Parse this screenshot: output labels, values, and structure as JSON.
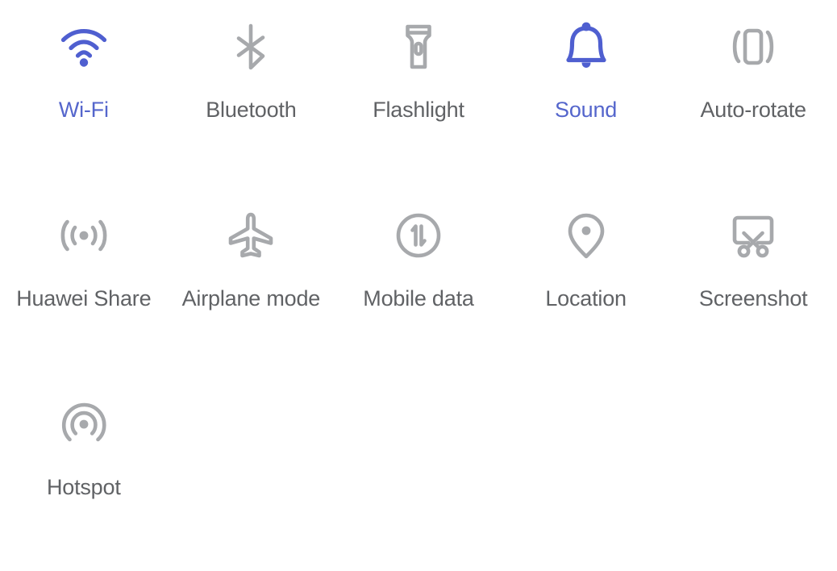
{
  "panel": {
    "name": "quick-settings",
    "background_color": "#ffffff",
    "columns": 5,
    "rows": 3
  },
  "colors": {
    "active_blue": "#5566cc",
    "active_icon_blue": "#4f5fd0",
    "inactive_gray_text": "#606265",
    "inactive_gray_icon": "#a7a9ac",
    "background": "#ffffff"
  },
  "tiles": [
    {
      "label": "Wi-Fi",
      "icon": "wifi-icon",
      "state": "on"
    },
    {
      "label": "Bluetooth",
      "icon": "bluetooth-icon",
      "state": "off"
    },
    {
      "label": "Flashlight",
      "icon": "flashlight-icon",
      "state": "off"
    },
    {
      "label": "Sound",
      "icon": "bell-icon",
      "state": "on"
    },
    {
      "label": "Auto-rotate",
      "icon": "auto-rotate-icon",
      "state": "off"
    },
    {
      "label": "Huawei Share",
      "icon": "huawei-share-icon",
      "state": "off"
    },
    {
      "label": "Airplane mode",
      "icon": "airplane-icon",
      "state": "off"
    },
    {
      "label": "Mobile data",
      "icon": "mobile-data-icon",
      "state": "off"
    },
    {
      "label": "Location",
      "icon": "location-pin-icon",
      "state": "off"
    },
    {
      "label": "Screenshot",
      "icon": "screenshot-icon",
      "state": "off"
    },
    {
      "label": "Hotspot",
      "icon": "hotspot-icon",
      "state": "off"
    }
  ]
}
